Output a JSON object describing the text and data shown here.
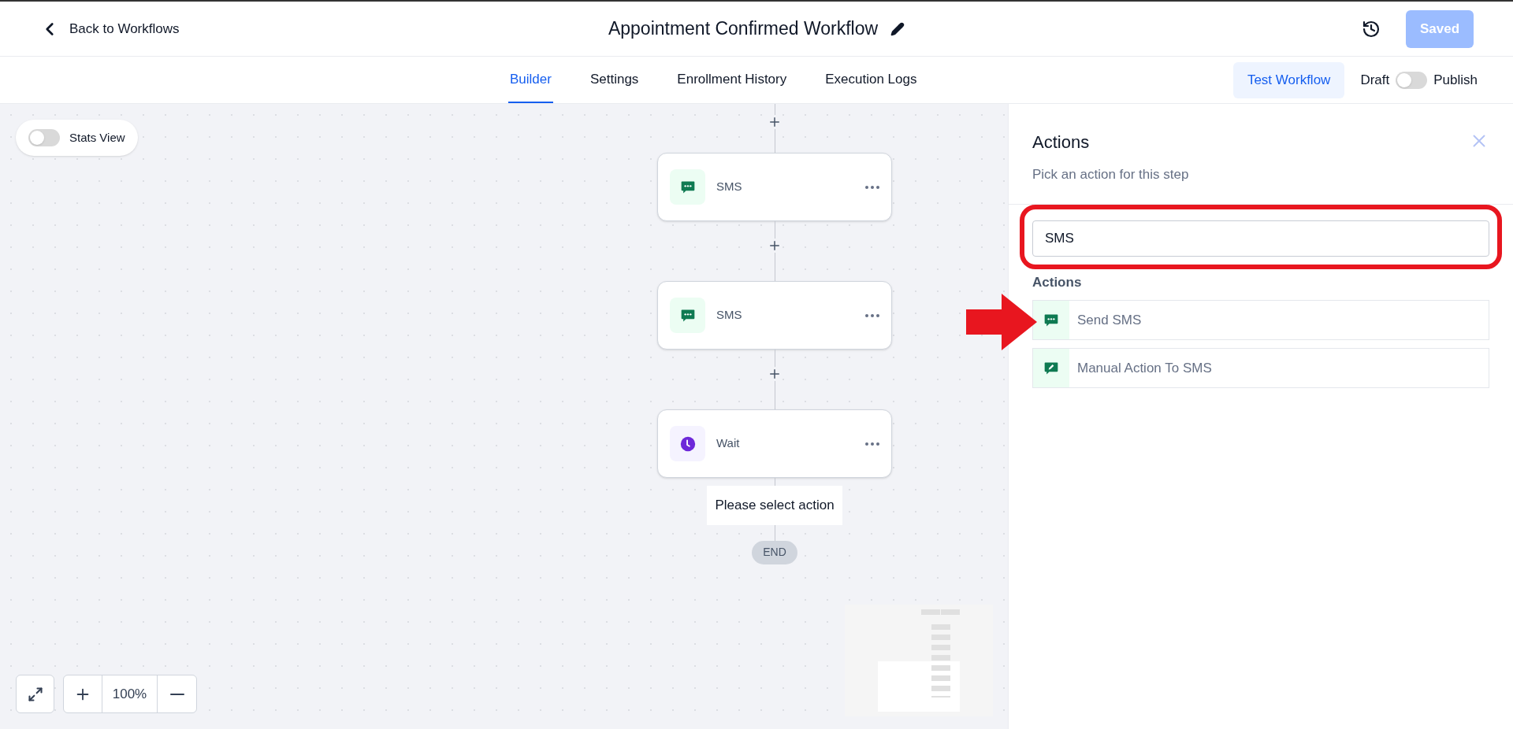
{
  "header": {
    "back_link": "Back to Workflows",
    "title": "Appointment Confirmed Workflow",
    "saved_button": {
      "label": "Saved",
      "disabled": true
    }
  },
  "tabs": [
    {
      "label": "Builder",
      "selected": true
    },
    {
      "label": "Settings",
      "selected": false
    },
    {
      "label": "Enrollment History",
      "selected": false
    },
    {
      "label": "Execution Logs",
      "selected": false
    }
  ],
  "test_button": "Test Workflow",
  "publish_toggle": {
    "off_label": "Draft",
    "on_label": "Publish",
    "on": false
  },
  "stats_view": {
    "label": "Stats View",
    "on": false
  },
  "nodes": [
    {
      "kind": "sms",
      "label": "SMS"
    },
    {
      "kind": "sms",
      "label": "SMS"
    },
    {
      "kind": "wait",
      "label": "Wait"
    }
  ],
  "hint": "Please select action",
  "end": "END",
  "zoom_level": "100%",
  "panel": {
    "title": "Actions",
    "subtitle": "Pick an action for this step",
    "search": {
      "value": "SMS"
    },
    "section": "Actions",
    "items": [
      {
        "kind": "sms",
        "label": "Send SMS"
      },
      {
        "kind": "manual",
        "label": "Manual Action To SMS"
      }
    ]
  }
}
